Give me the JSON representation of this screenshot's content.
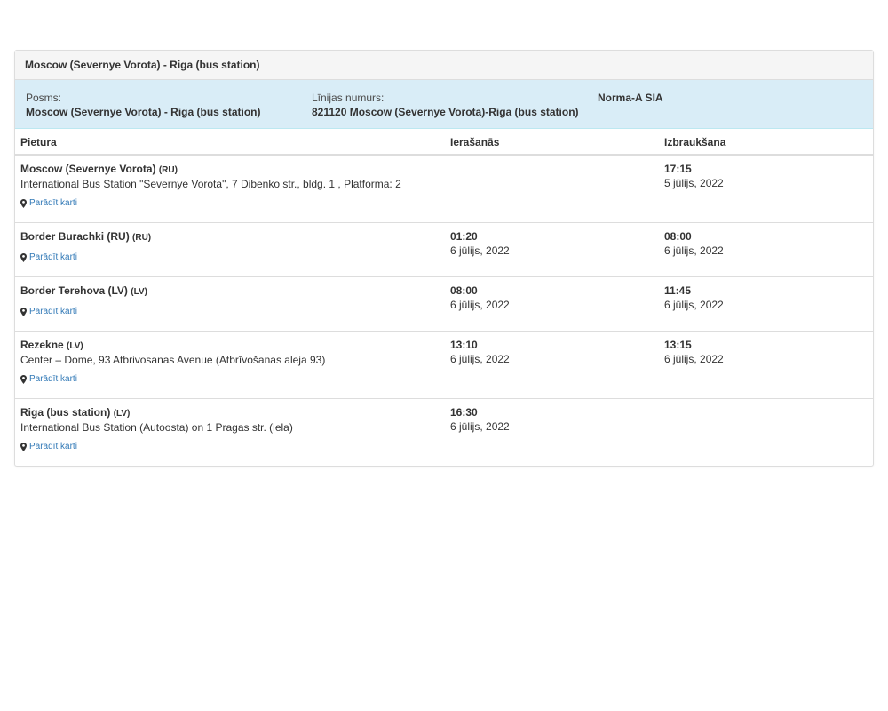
{
  "panel": {
    "title": "Moscow (Severnye Vorota) - Riga (bus station)"
  },
  "info": {
    "segment_label": "Posms:",
    "segment_value": "Moscow (Severnye Vorota) - Riga (bus station)",
    "line_label": "Līnijas numurs:",
    "line_value": "821120 Moscow (Severnye Vorota)-Riga (bus station)",
    "operator": "Norma-A SIA"
  },
  "table": {
    "headers": {
      "stop": "Pietura",
      "arrival": "Ierašanās",
      "departure": "Izbraukšana"
    },
    "map_link_label": "Parādīt karti",
    "rows": [
      {
        "name": "Moscow (Severnye Vorota)",
        "country": "(RU)",
        "address": "International Bus Station \"Severnye Vorota\", 7 Dibenko str., bldg. 1 , Platforma: 2",
        "arrival_time": "",
        "arrival_date": "",
        "departure_time": "17:15",
        "departure_date": "5 jūlijs, 2022"
      },
      {
        "name": "Border Burachki (RU)",
        "country": "(RU)",
        "address": "",
        "arrival_time": "01:20",
        "arrival_date": "6 jūlijs, 2022",
        "departure_time": "08:00",
        "departure_date": "6 jūlijs, 2022"
      },
      {
        "name": "Border Terehova (LV)",
        "country": "(LV)",
        "address": "",
        "arrival_time": "08:00",
        "arrival_date": "6 jūlijs, 2022",
        "departure_time": "11:45",
        "departure_date": "6 jūlijs, 2022"
      },
      {
        "name": "Rezekne",
        "country": "(LV)",
        "address": "Center – Dome, 93 Atbrivosanas Avenue (Atbrīvošanas aleja 93)",
        "arrival_time": "13:10",
        "arrival_date": "6 jūlijs, 2022",
        "departure_time": "13:15",
        "departure_date": "6 jūlijs, 2022"
      },
      {
        "name": "Riga (bus station)",
        "country": "(LV)",
        "address": "International Bus Station (Autoosta) on 1 Pragas str. (iela)",
        "arrival_time": "16:30",
        "arrival_date": "6 jūlijs, 2022",
        "departure_time": "",
        "departure_date": ""
      }
    ]
  },
  "icons": {
    "map_pin": "map-pin-icon"
  },
  "colors": {
    "info_background": "#d9edf7",
    "heading_background": "#f5f5f5",
    "link": "#337ab7"
  }
}
